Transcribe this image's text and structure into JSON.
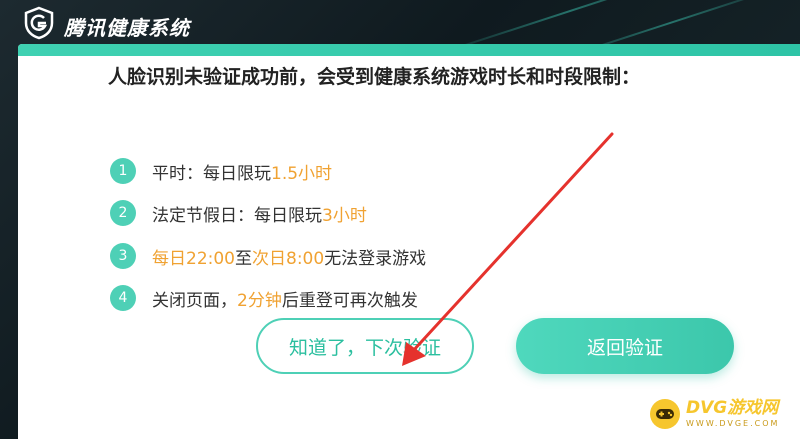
{
  "app": {
    "title": "腾讯健康系统",
    "brand_color": "#4ed0b6",
    "highlight_color": "#f0a232"
  },
  "notice": {
    "heading": "人脸识别未验证成功前，会受到健康系统游戏时长和时段限制：",
    "items": [
      {
        "num": "1",
        "parts": [
          {
            "text": "平时：每日限玩 ",
            "hl": false
          },
          {
            "text": "1.5小时",
            "hl": true
          }
        ]
      },
      {
        "num": "2",
        "parts": [
          {
            "text": "法定节假日：每日限玩 ",
            "hl": false
          },
          {
            "text": "3小时",
            "hl": true
          }
        ]
      },
      {
        "num": "3",
        "parts": [
          {
            "text": "每日22:00",
            "hl": true
          },
          {
            "text": "至",
            "hl": false
          },
          {
            "text": "次日8:00",
            "hl": true
          },
          {
            "text": " 无法登录游戏",
            "hl": false
          }
        ]
      },
      {
        "num": "4",
        "parts": [
          {
            "text": "关闭页面，",
            "hl": false
          },
          {
            "text": "2分钟",
            "hl": true
          },
          {
            "text": "后重登可再次触发",
            "hl": false
          }
        ]
      }
    ]
  },
  "buttons": {
    "later": "知道了，下次验证",
    "back": "返回验证"
  },
  "watermark": {
    "main": "DVG游戏网",
    "sub": "WWW.DVGE.COM"
  }
}
